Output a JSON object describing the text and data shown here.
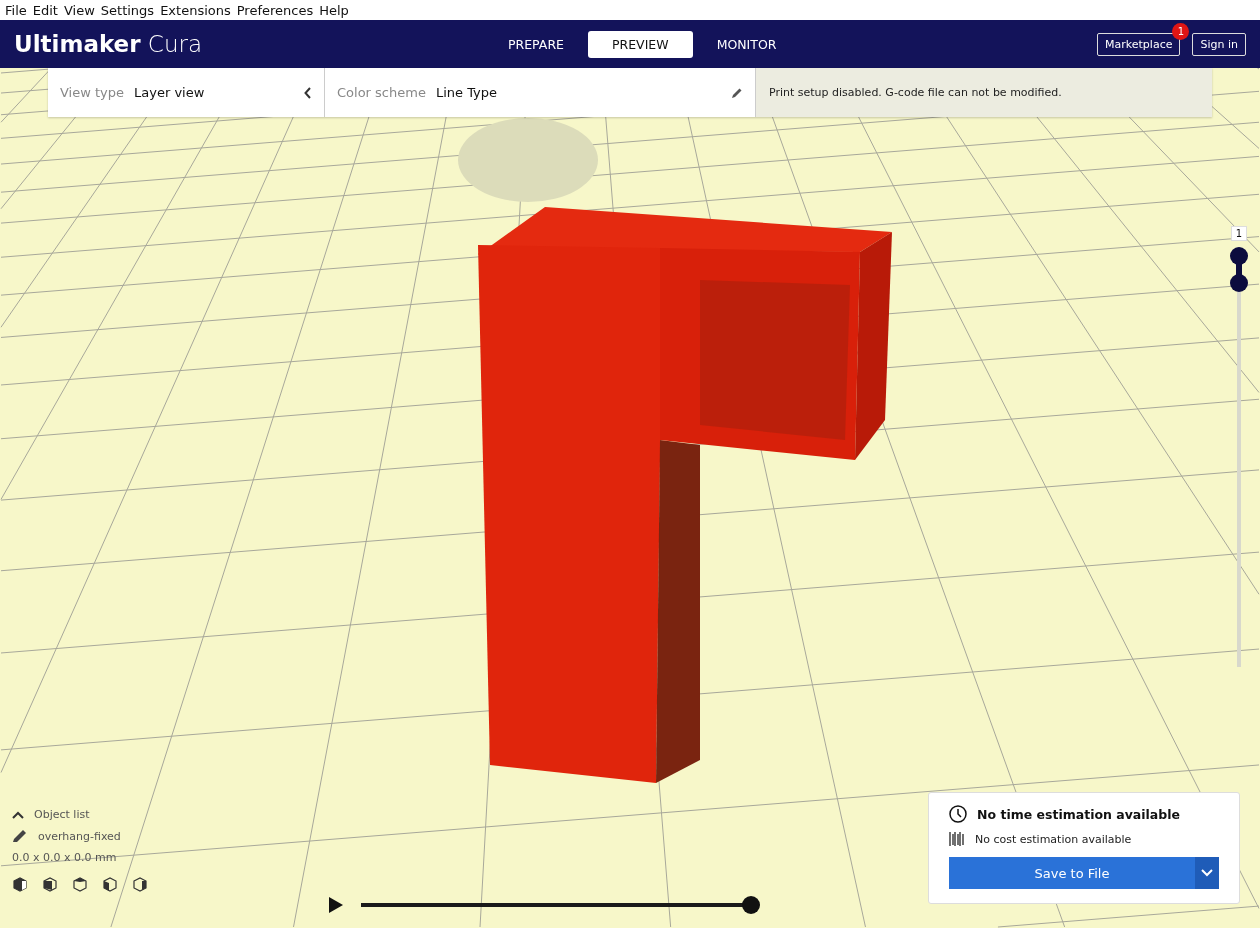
{
  "menu_bar": [
    {
      "label": "File"
    },
    {
      "label": "Edit"
    },
    {
      "label": "View"
    },
    {
      "label": "Settings"
    },
    {
      "label": "Extensions"
    },
    {
      "label": "Preferences"
    },
    {
      "label": "Help"
    }
  ],
  "header": {
    "logo": "**Ultimaker** Cura",
    "stages": [
      {
        "label": "PREPARE",
        "selected": false
      },
      {
        "label": "PREVIEW",
        "selected": true
      },
      {
        "label": "MONITOR",
        "selected": false
      }
    ],
    "marketplace": {
      "label": "Marketplace",
      "badge": "1"
    },
    "sign_in": "Sign in"
  },
  "view_panel": {
    "view_type_label": "View type",
    "view_type": "Layer view",
    "color_scheme_label": "Color scheme",
    "color_scheme": "Line Type",
    "message": "Print setup disabled. G-code file can not be modified."
  },
  "layer_slider": {
    "label": "1",
    "level": 1
  },
  "object_list": {
    "title": "Object list",
    "object_name": "overhang-fixed",
    "dimensions": "0.0 x 0.0 x 0.0 mm"
  },
  "playback": {
    "level": 1
  },
  "print_summary": {
    "time": "No time estimation available",
    "cost": "No cost estimation available",
    "button": "Save to File"
  }
}
